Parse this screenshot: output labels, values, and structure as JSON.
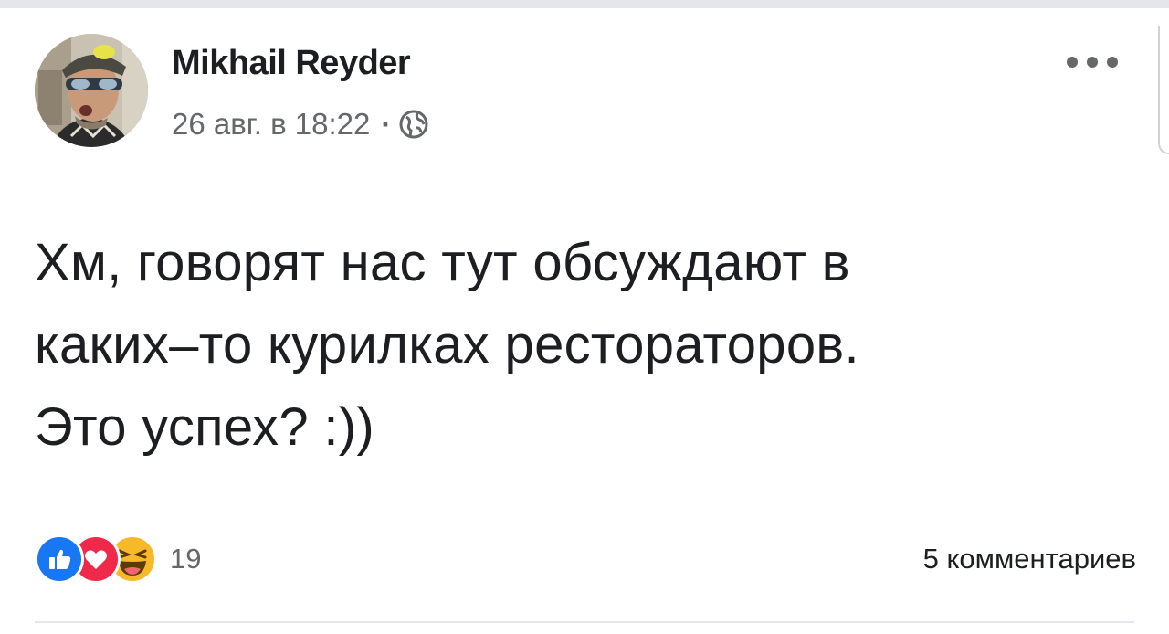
{
  "post": {
    "author": "Mikhail Reyder",
    "timestamp": "26 авг. в 18:22",
    "separator": "·",
    "privacy_icon": "globe-icon",
    "more_icon": "more-options-icon",
    "text_lines": [
      "Хм, говорят нас тут обсуждают в",
      "каких–то курилках рестораторов.",
      "Это успех? :))"
    ]
  },
  "footer": {
    "reactions": [
      "like-icon",
      "love-icon",
      "haha-icon"
    ],
    "reaction_count": "19",
    "comments_label": "5 комментариев"
  },
  "colors": {
    "like": "#1877f2",
    "love": "#f02849",
    "haha": "#f7b928",
    "text_primary": "#1c1e21",
    "text_secondary": "#65676b"
  }
}
